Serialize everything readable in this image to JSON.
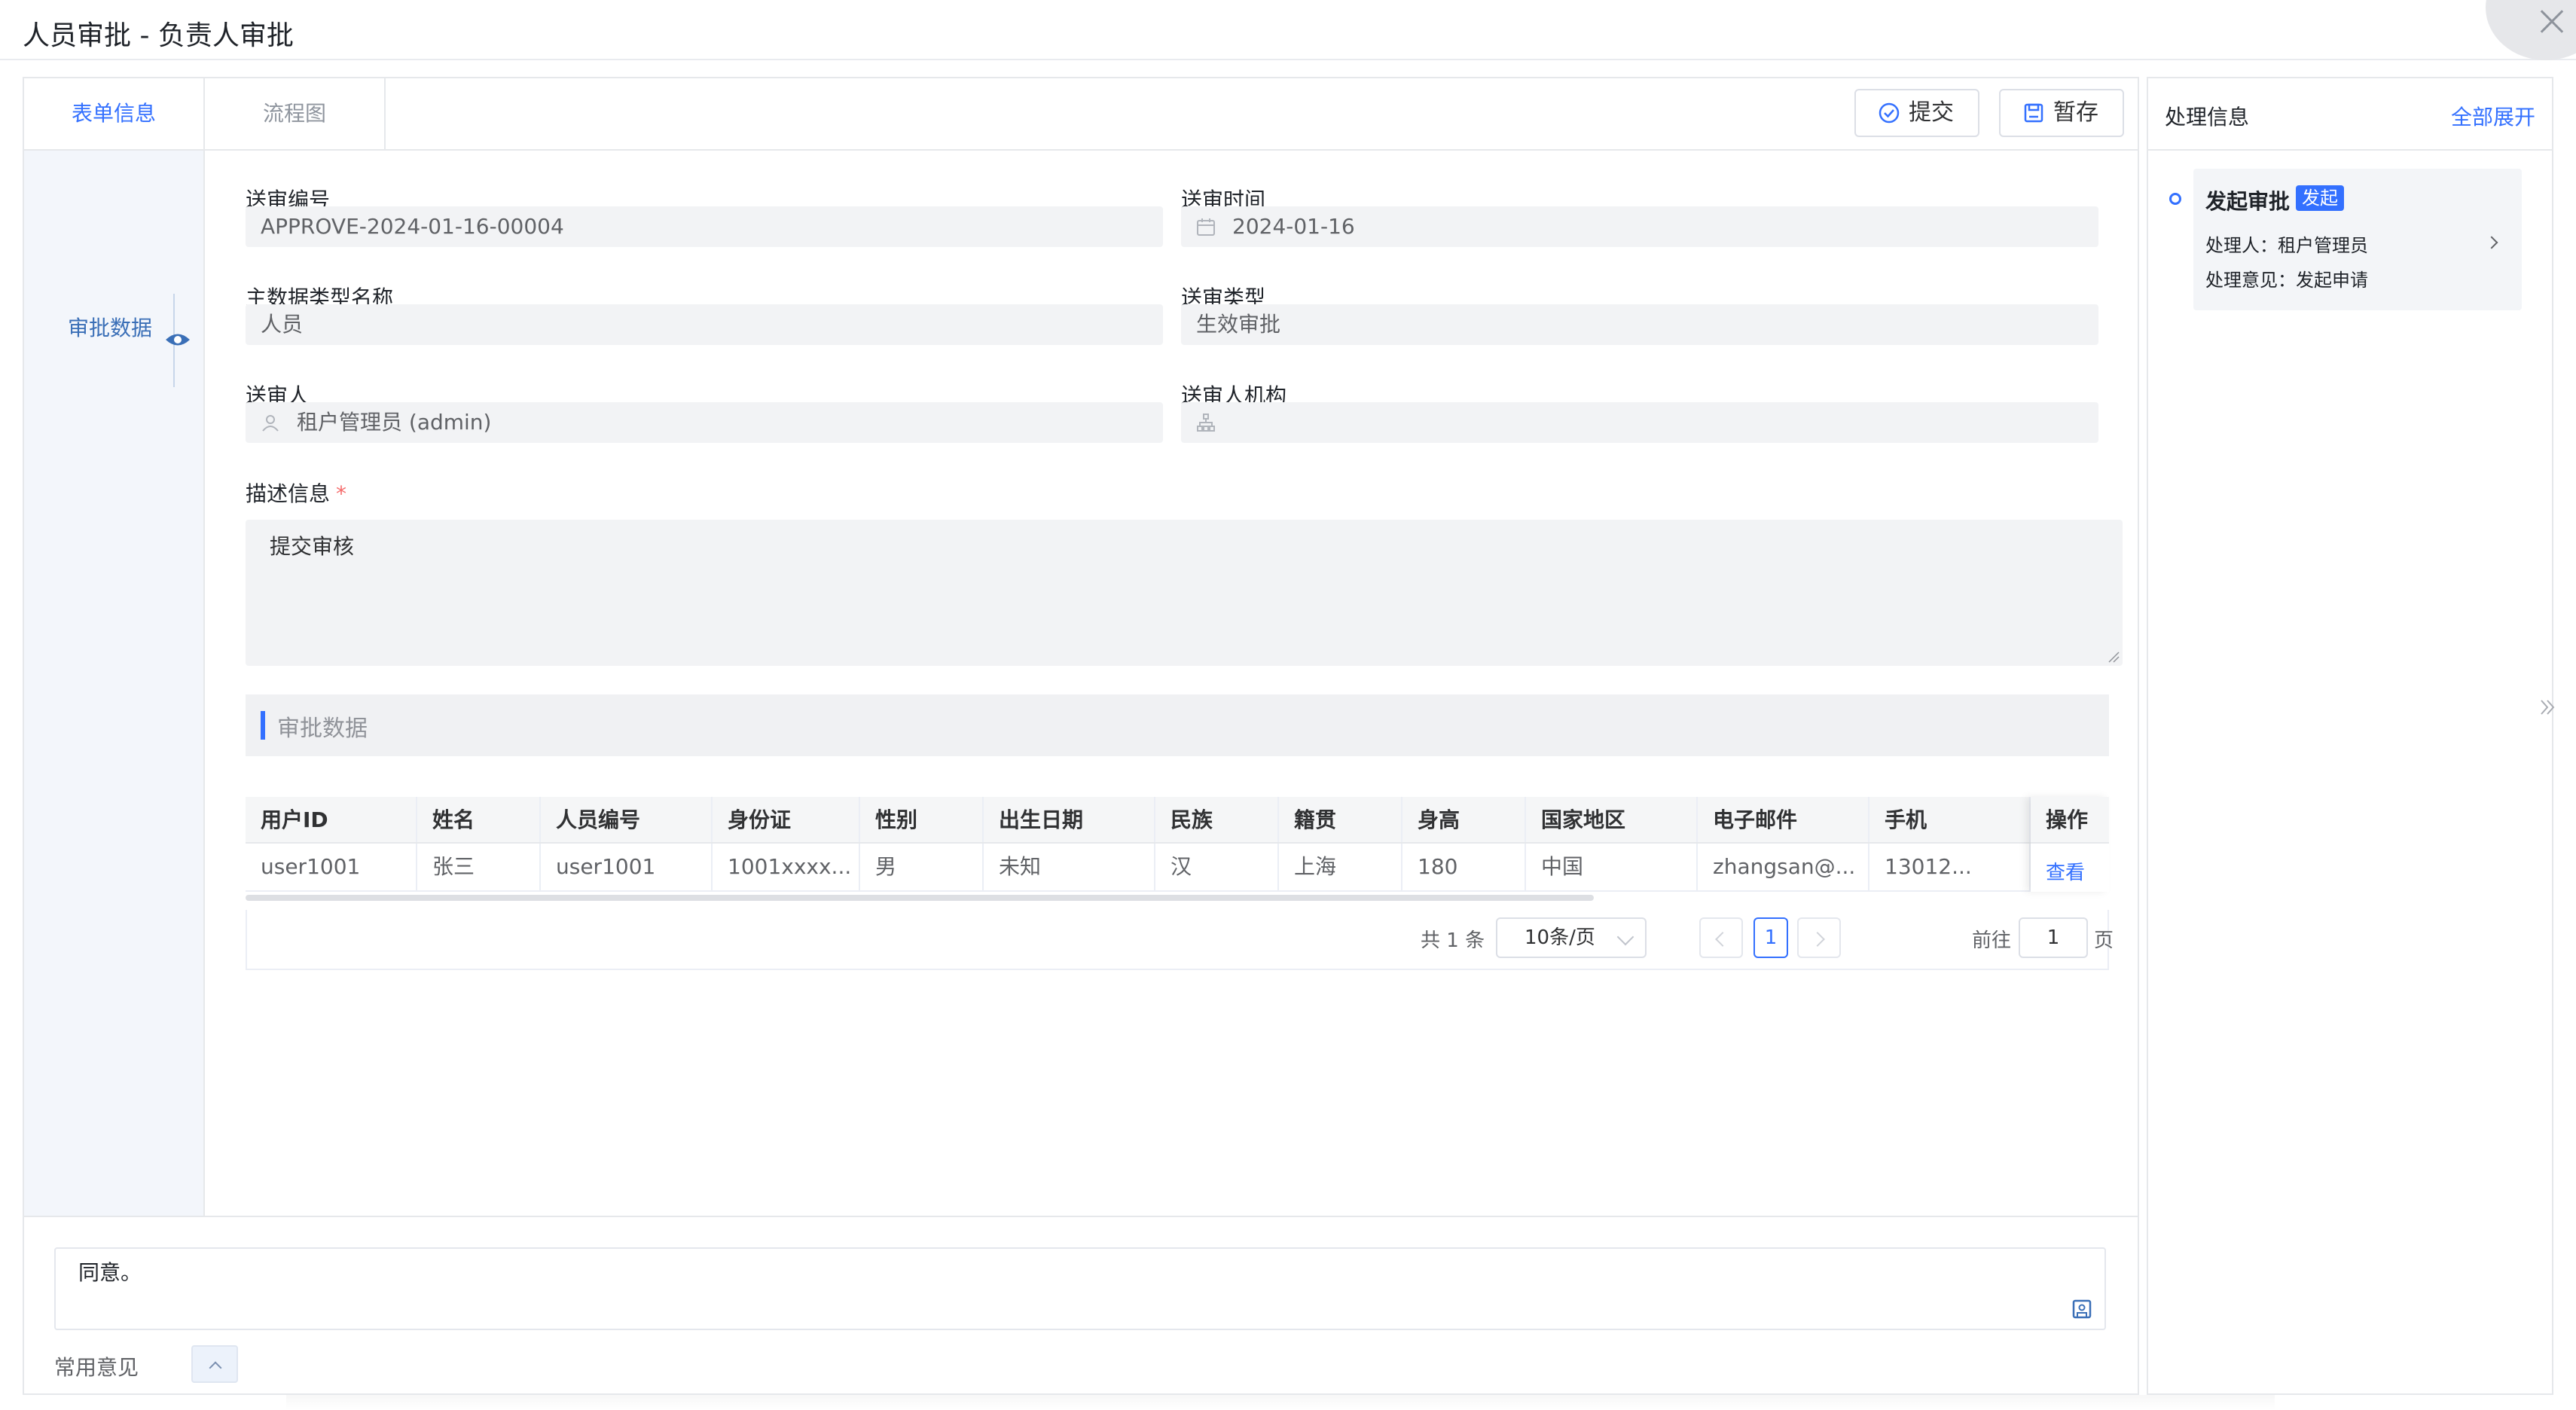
{
  "window": {
    "title": "人员审批 - 负责人审批"
  },
  "tabs": [
    {
      "label": "表单信息",
      "active": true
    },
    {
      "label": "流程图",
      "active": false
    }
  ],
  "toolbar": {
    "submit_label": "提交",
    "save_label": "暂存"
  },
  "anchor": {
    "label": "审批数据"
  },
  "form": {
    "review_no": {
      "label": "送审编号",
      "value": "APPROVE-2024-01-16-00004"
    },
    "review_time": {
      "label": "送审时间",
      "value": "2024-01-16"
    },
    "master_type": {
      "label": "主数据类型名称",
      "value": "人员"
    },
    "review_type": {
      "label": "送审类型",
      "value": "生效审批"
    },
    "submitter": {
      "label": "送审人",
      "value": "租户管理员 (admin)"
    },
    "submitter_org": {
      "label": "送审人机构",
      "value": ""
    },
    "description": {
      "label": "描述信息",
      "required_mark": "*",
      "value": "提交审核"
    }
  },
  "section": {
    "title": "审批数据"
  },
  "table": {
    "columns": [
      "用户ID",
      "姓名",
      "人员编号",
      "身份证",
      "性别",
      "出生日期",
      "民族",
      "籍贯",
      "身高",
      "国家地区",
      "电子邮件",
      "手机"
    ],
    "rows": [
      [
        "user1001",
        "张三",
        "user1001",
        "1001xxxx...",
        "男",
        "未知",
        "汉",
        "上海",
        "180",
        "中国",
        "zhangsan@...",
        "13012..."
      ]
    ],
    "op_header": "操作",
    "op_link": "查看"
  },
  "pagination": {
    "total_text": "共 1 条",
    "page_size": "10条/页",
    "current_page": "1",
    "goto_label": "前往",
    "goto_value": "1",
    "page_unit": "页"
  },
  "comment": {
    "value": "同意。",
    "common_label": "常用意见"
  },
  "side": {
    "title": "处理信息",
    "expand_all": "全部展开",
    "timeline": [
      {
        "title": "发起审批",
        "badge": "发起",
        "handler": "处理人：租户管理员",
        "opinion": "处理意见：发起申请"
      }
    ]
  },
  "colors": {
    "accent": "#3370ff",
    "anchor_text": "#3a6fb7"
  }
}
